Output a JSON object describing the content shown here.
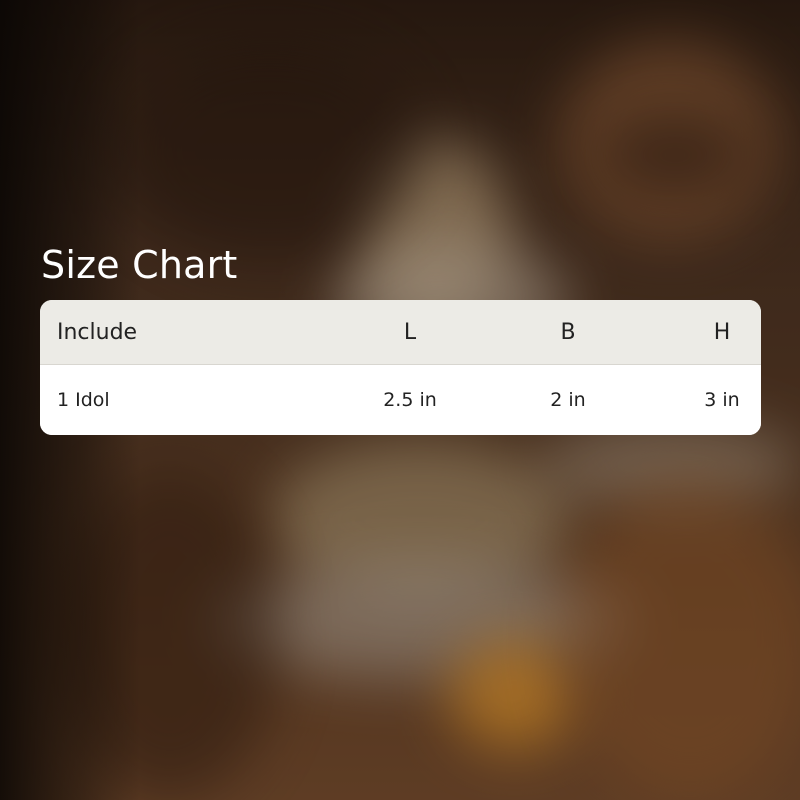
{
  "title": "Size Chart",
  "table": {
    "headers": [
      "Include",
      "L",
      "B",
      "H"
    ],
    "rows": [
      [
        "1 Idol",
        "2.5 in",
        "2 in",
        "3 in"
      ]
    ]
  },
  "colors": {
    "header_bg": "#ecebe6",
    "row_bg": "#ffffff",
    "text": "#222222",
    "title": "#ffffff"
  }
}
